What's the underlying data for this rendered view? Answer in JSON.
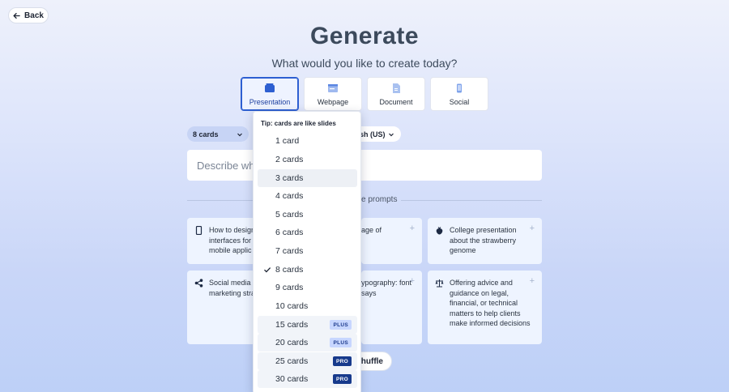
{
  "header": {
    "back_label": "Back",
    "title": "Generate",
    "subtitle": "What would you like to create today?"
  },
  "types": [
    {
      "label": "Presentation",
      "icon": "presentation-icon",
      "selected": true
    },
    {
      "label": "Webpage",
      "icon": "webpage-icon",
      "selected": false
    },
    {
      "label": "Document",
      "icon": "document-icon",
      "selected": false
    },
    {
      "label": "Social",
      "icon": "social-icon",
      "selected": false
    }
  ],
  "controls": {
    "cards_value": "8 cards",
    "language_value_visible": "sh (US)"
  },
  "prompt": {
    "placeholder_visible": "Describe what"
  },
  "examples": {
    "label_visible": "e prompts",
    "items": [
      {
        "text": "How to design interfaces for mobile applic",
        "icon": "mobile-icon"
      },
      {
        "text": "age of",
        "icon": ""
      },
      {
        "text": "College presentation about the strawberry genome",
        "icon": "strawberry-icon"
      },
      {
        "text": "Social media marketing stra",
        "icon": "share-icon"
      },
      {
        "text": "ypography: font says",
        "icon": ""
      },
      {
        "text": "Offering advice and guidance on legal, financial, or technical matters to help clients make informed decisions",
        "icon": "scales-icon"
      }
    ],
    "shuffle_visible": "shuffle"
  },
  "dropdown": {
    "tip": "Tip: cards are like slides",
    "items": [
      {
        "label": "1 card",
        "badge": ""
      },
      {
        "label": "2 cards",
        "badge": ""
      },
      {
        "label": "3 cards",
        "badge": ""
      },
      {
        "label": "4 cards",
        "badge": ""
      },
      {
        "label": "5 cards",
        "badge": ""
      },
      {
        "label": "6 cards",
        "badge": ""
      },
      {
        "label": "7 cards",
        "badge": ""
      },
      {
        "label": "8 cards",
        "badge": ""
      },
      {
        "label": "9 cards",
        "badge": ""
      },
      {
        "label": "10 cards",
        "badge": ""
      },
      {
        "label": "15 cards",
        "badge": "PLUS"
      },
      {
        "label": "20 cards",
        "badge": "PLUS"
      },
      {
        "label": "25 cards",
        "badge": "PRO"
      },
      {
        "label": "30 cards",
        "badge": "PRO"
      }
    ],
    "selected": "8 cards",
    "hovered": "3 cards"
  },
  "colors": {
    "accent": "#2d5fd1",
    "pro_badge": "#173a8c",
    "plus_badge": "#c7d6ff"
  }
}
